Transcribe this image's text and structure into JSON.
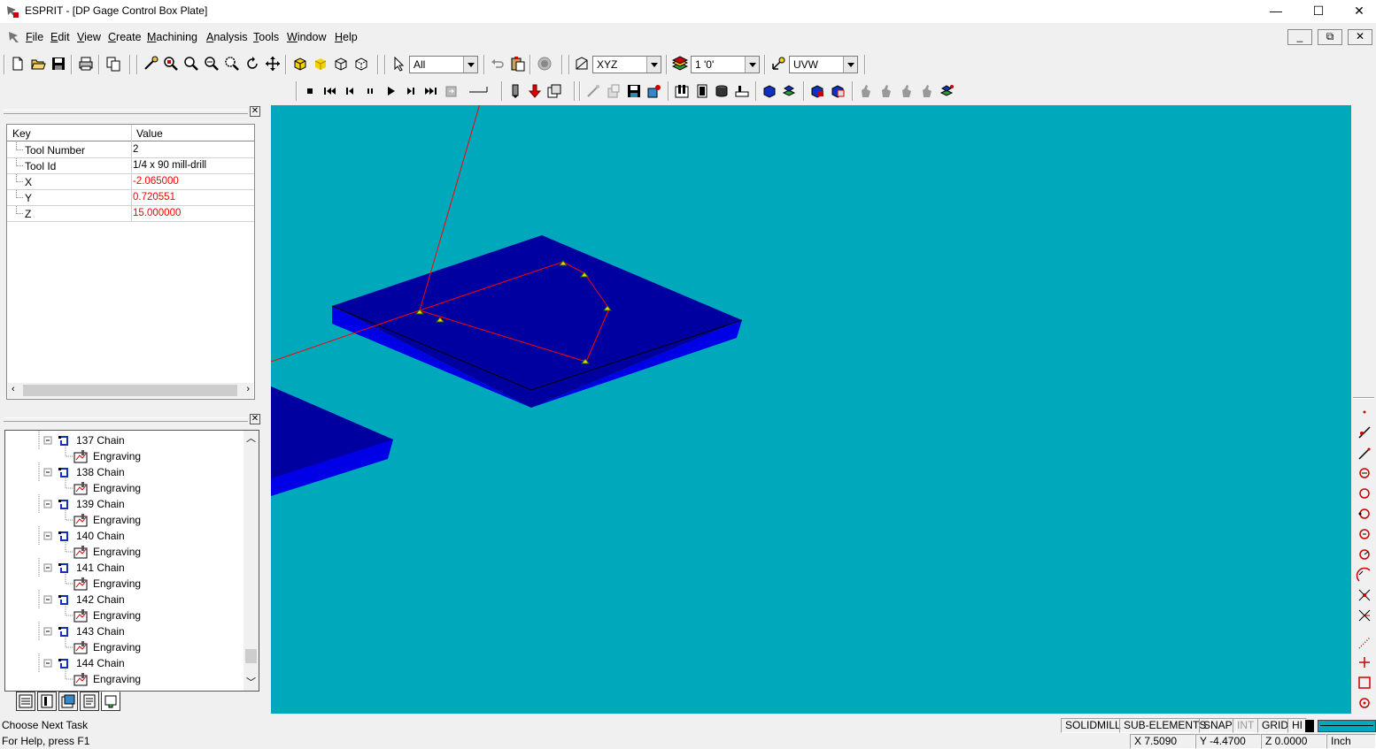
{
  "window": {
    "title": "ESPRIT - [DP Gage Control Box Plate]",
    "minimize": "—",
    "maximize": "☐",
    "close": "✕"
  },
  "menu": [
    "File",
    "Edit",
    "View",
    "Create",
    "Machining",
    "Analysis",
    "Tools",
    "Window",
    "Help"
  ],
  "mdi": {
    "minimize": "_",
    "restore": "⧉",
    "close": "✕"
  },
  "toolbar": {
    "filter_value": "All",
    "plane_value": "XYZ",
    "layer_value": "1 '0'",
    "workplane_value": "UVW"
  },
  "properties": {
    "header_key": "Key",
    "header_value": "Value",
    "rows": [
      {
        "key": "Tool Number",
        "value": "2",
        "color": "#000000"
      },
      {
        "key": "Tool Id",
        "value": "1/4 x 90 mill-drill",
        "color": "#000000"
      },
      {
        "key": "X",
        "value": "-2.065000",
        "color": "#ff0000"
      },
      {
        "key": "Y",
        "value": "0.720551",
        "color": "#ff0000"
      },
      {
        "key": "Z",
        "value": "15.000000",
        "color": "#ff0000"
      }
    ]
  },
  "tree": {
    "items": [
      {
        "chain": "137 Chain",
        "op": "Engraving"
      },
      {
        "chain": "138 Chain",
        "op": "Engraving"
      },
      {
        "chain": "139 Chain",
        "op": "Engraving"
      },
      {
        "chain": "140 Chain",
        "op": "Engraving"
      },
      {
        "chain": "141 Chain",
        "op": "Engraving"
      },
      {
        "chain": "142 Chain",
        "op": "Engraving"
      },
      {
        "chain": "143 Chain",
        "op": "Engraving"
      },
      {
        "chain": "144 Chain",
        "op": "Engraving"
      }
    ]
  },
  "colors": {
    "viewport": "#00a8bc",
    "plate_top": "#0000a0",
    "plate_side": "#0000e6",
    "toolpath": "#ff0000"
  },
  "status": {
    "prompt": "Choose Next Task",
    "help": "For Help, press F1",
    "mode": "SOLIDMILL",
    "sub_elements": "SUB-ELEMENTS",
    "snap": "SNAP",
    "int": "INT",
    "grid": "GRID",
    "hi": "HI",
    "x": "X 7.5090",
    "y": "Y -4.4700",
    "z": "Z 0.0000",
    "units": "Inch"
  }
}
